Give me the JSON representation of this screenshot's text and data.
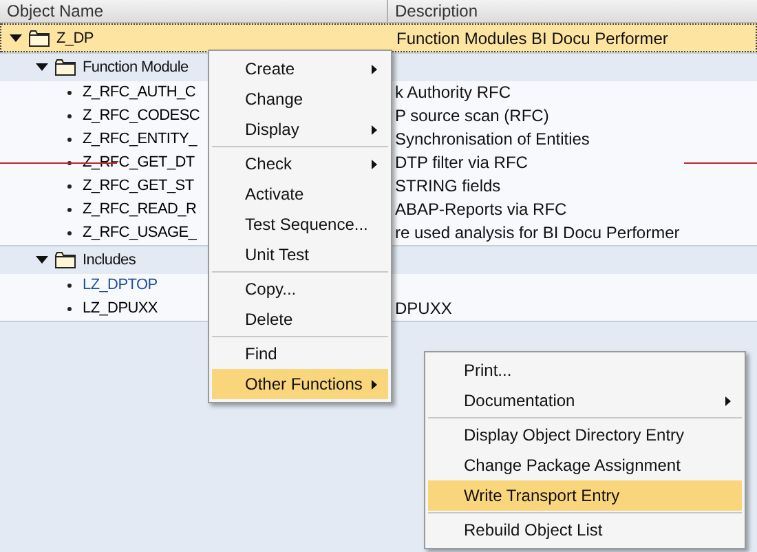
{
  "columns": [
    "Object Name",
    "Description"
  ],
  "tree": [
    {
      "name": "Z_DP",
      "description": "Function Modules BI Docu Performer",
      "selected": true,
      "expanded": true,
      "children": [
        {
          "name": "Function Module",
          "expanded": true,
          "selected": false,
          "children": [
            {
              "name": "Z_RFC_AUTH_C",
              "description": "k Authority RFC",
              "color": "#000000",
              "marked": false
            },
            {
              "name": "Z_RFC_CODESC",
              "description": "P source scan (RFC)",
              "color": "#000000",
              "marked": false
            },
            {
              "name": "Z_RFC_ENTITY_",
              "description": "Synchronisation of Entities",
              "color": "#000000",
              "marked": false
            },
            {
              "name": "Z_RFC_GET_DT",
              "description": "DTP filter via RFC",
              "color": "#000000",
              "marked": true
            },
            {
              "name": "Z_RFC_GET_ST",
              "description": "STRING fields",
              "color": "#000000",
              "marked": false
            },
            {
              "name": "Z_RFC_READ_R",
              "description": "ABAP-Reports via RFC",
              "color": "#000000",
              "marked": false
            },
            {
              "name": "Z_RFC_USAGE_",
              "description": "re used analysis for BI Docu Performer",
              "color": "#000000",
              "marked": false
            }
          ]
        },
        {
          "name": "Includes",
          "expanded": true,
          "selected": false,
          "children": [
            {
              "name": "LZ_DPTOP",
              "color": "#1c4f9c",
              "marked": false
            },
            {
              "name": "LZ_DPUXX",
              "description": "DPUXX",
              "color": "#000000",
              "marked": false
            }
          ]
        }
      ]
    }
  ],
  "context_menu": {
    "sections": [
      [
        {
          "label": "Create",
          "submenu": true,
          "selected": false
        },
        {
          "label": "Change",
          "submenu": false,
          "selected": false
        },
        {
          "label": "Display",
          "submenu": true,
          "selected": false
        }
      ],
      [
        {
          "label": "Check",
          "submenu": true,
          "selected": false
        },
        {
          "label": "Activate",
          "submenu": false,
          "selected": false
        },
        {
          "label": "Test Sequence...",
          "submenu": false,
          "selected": false
        },
        {
          "label": "Unit Test",
          "submenu": false,
          "selected": false
        }
      ],
      [
        {
          "label": "Copy...",
          "submenu": false,
          "selected": false
        },
        {
          "label": "Delete",
          "submenu": false,
          "selected": false
        }
      ],
      [
        {
          "label": "Find",
          "submenu": false,
          "selected": false
        },
        {
          "label": "Other Functions",
          "submenu": true,
          "selected": true
        }
      ]
    ]
  },
  "submenu": {
    "sections": [
      [
        {
          "label": "Print...",
          "submenu": false,
          "selected": false
        },
        {
          "label": "Documentation",
          "submenu": true,
          "selected": false
        }
      ],
      [
        {
          "label": "Display Object Directory Entry",
          "submenu": false,
          "selected": false
        },
        {
          "label": "Change Package Assignment",
          "submenu": false,
          "selected": false
        },
        {
          "label": "Write Transport Entry",
          "submenu": false,
          "selected": true
        }
      ],
      [
        {
          "label": "Rebuild Object List",
          "submenu": false,
          "selected": false
        }
      ]
    ]
  }
}
